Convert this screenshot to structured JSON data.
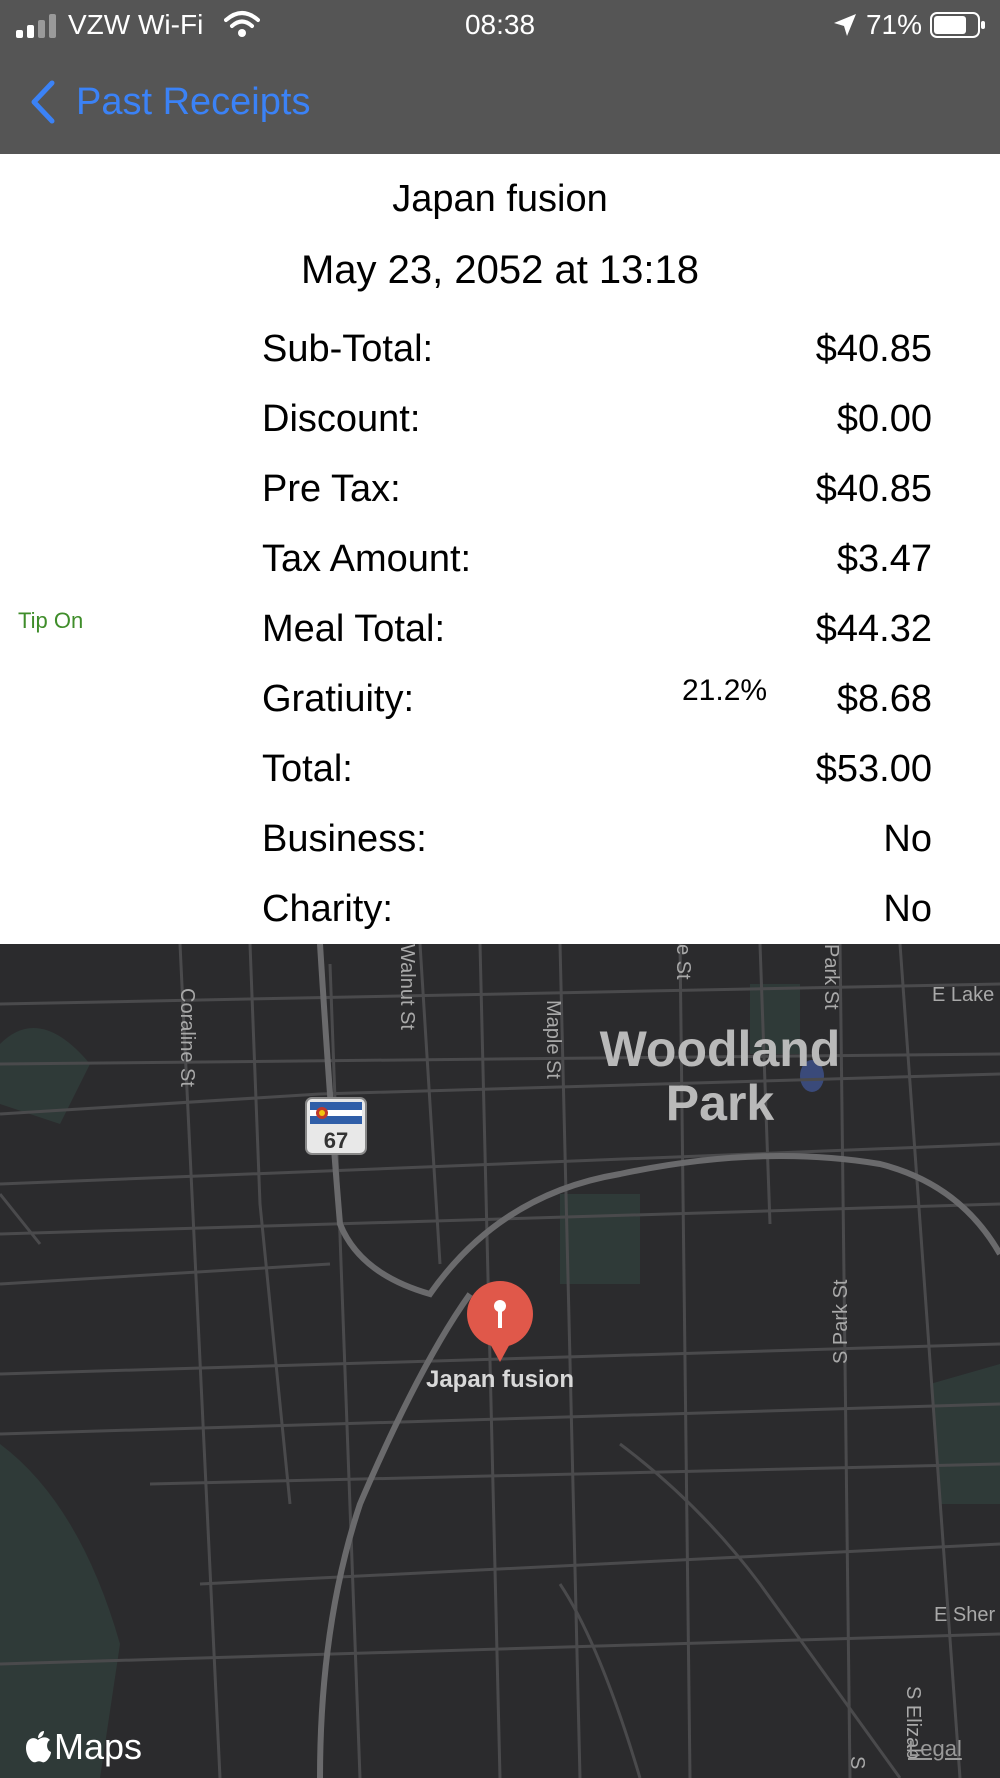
{
  "status_bar": {
    "carrier": "VZW Wi-Fi",
    "time": "08:38",
    "battery": "71%"
  },
  "nav": {
    "back_label": "Past Receipts"
  },
  "receipt": {
    "restaurant": "Japan fusion",
    "datetime": "May 23, 2052 at 13:18",
    "tip_indicator": "Tip On",
    "rows": [
      {
        "label": "Sub-Total:",
        "value": "$40.85"
      },
      {
        "label": "Discount:",
        "value": "$0.00"
      },
      {
        "label": "Pre Tax:",
        "value": "$40.85"
      },
      {
        "label": "Tax Amount:",
        "value": "$3.47"
      },
      {
        "label": "Meal Total:",
        "value": "$44.32"
      },
      {
        "label": "Gratiuity:",
        "value": "$8.68",
        "percent": "21.2%"
      },
      {
        "label": "Total:",
        "value": "$53.00"
      },
      {
        "label": "Business:",
        "value": "No"
      },
      {
        "label": "Charity:",
        "value": "No"
      }
    ]
  },
  "map": {
    "area_name": "Woodland Park",
    "area_line1": "Woodland",
    "area_line2": "Park",
    "pin_label": "Japan fusion",
    "route_shield": "67",
    "streets": {
      "coraline": "Coraline St",
      "walnut": "Walnut St",
      "maple": "Maple St",
      "e_st": "e St",
      "park_top": "Park St",
      "e_lake": "E Lake",
      "s_park": "S Park St",
      "e_sher": "E Sher",
      "s_eliz": "S Elizab",
      "s_bottom": "S"
    },
    "brand": "Maps",
    "legal": "Legal"
  },
  "colors": {
    "accent_blue": "#3b82f6",
    "tip_green": "#3f8d2a",
    "pin_red": "#e0584a",
    "nav_bg": "#555555",
    "map_bg": "#2b2b2d"
  }
}
